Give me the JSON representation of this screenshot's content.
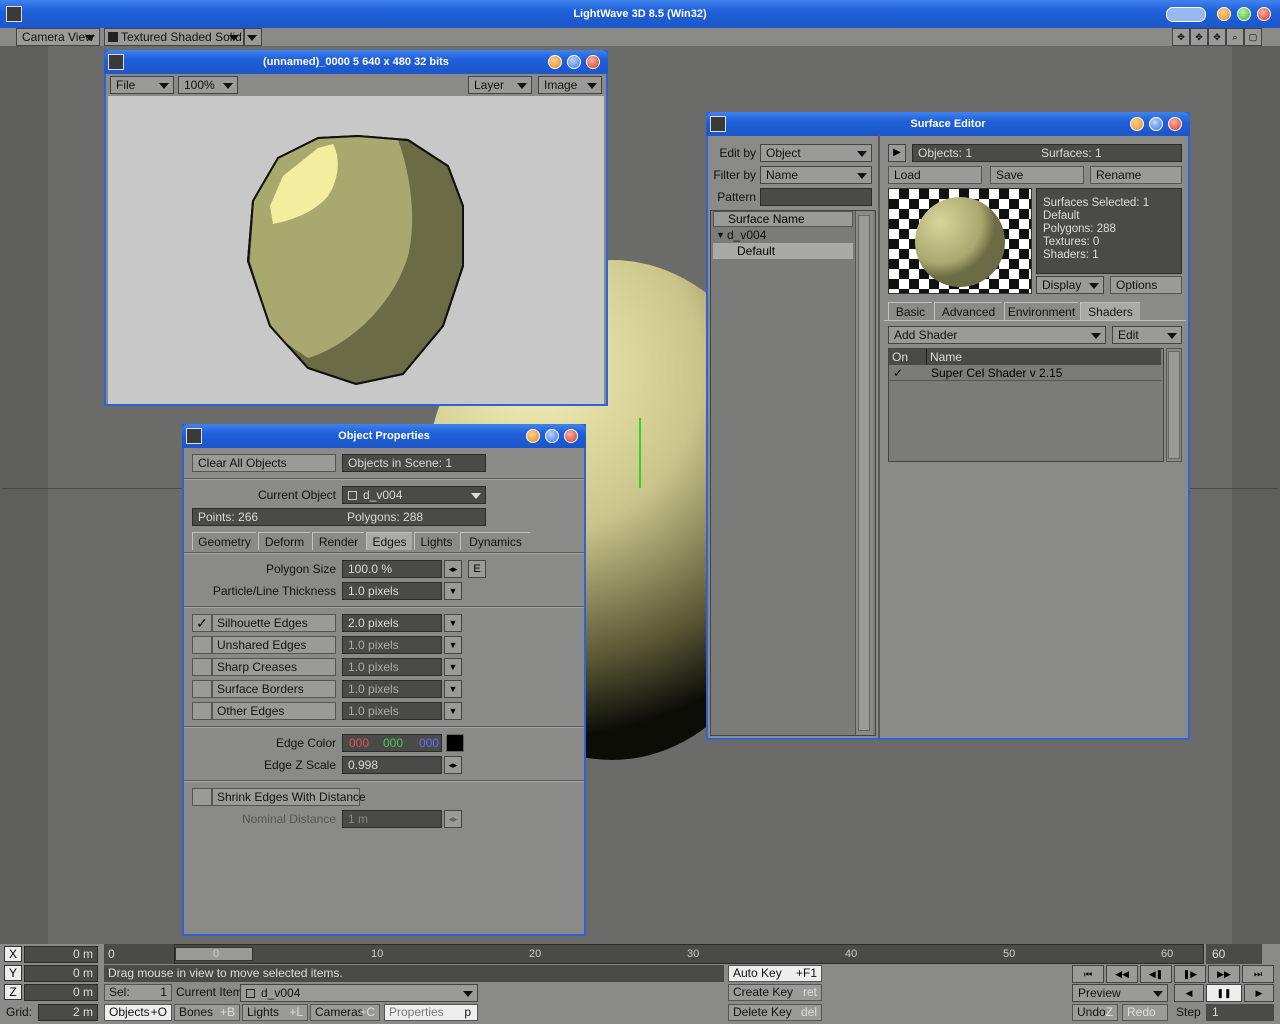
{
  "app": {
    "title": "LightWave 3D 8.5 (Win32)"
  },
  "viewport": {
    "view_mode": "Camera View",
    "shading_mode": "Textured Shaded Solid"
  },
  "render_window": {
    "title": "(unnamed)_0000 5  640 x 480 32 bits",
    "file": "File",
    "zoom": "100%",
    "layer": "Layer",
    "image": "Image"
  },
  "object_properties": {
    "title": "Object Properties",
    "clear_all": "Clear All Objects",
    "objects_in_scene": "Objects in Scene: 1",
    "current_object_label": "Current Object",
    "current_object": "d_v004",
    "points": "Points: 266",
    "polygons": "Polygons: 288",
    "tabs": [
      "Geometry",
      "Deform",
      "Render",
      "Edges",
      "Lights",
      "Dynamics"
    ],
    "polygon_size_label": "Polygon Size",
    "polygon_size": "100.0 %",
    "e_btn": "E",
    "particle_label": "Particle/Line Thickness",
    "particle_value": "1.0 pixels",
    "edges": [
      {
        "label": "Silhouette Edges",
        "value": "2.0 pixels",
        "checked": "✓"
      },
      {
        "label": "Unshared Edges",
        "value": "1.0 pixels",
        "checked": ""
      },
      {
        "label": "Sharp Creases",
        "value": "1.0 pixels",
        "checked": ""
      },
      {
        "label": "Surface Borders",
        "value": "1.0 pixels",
        "checked": ""
      },
      {
        "label": "Other Edges",
        "value": "1.0 pixels",
        "checked": ""
      }
    ],
    "edge_color_label": "Edge Color",
    "edge_r": "000",
    "edge_g": "000",
    "edge_b": "000",
    "edge_z_label": "Edge Z Scale",
    "edge_z": "0.998",
    "shrink_label": "Shrink Edges With Distance",
    "nominal_label": "Nominal Distance",
    "nominal_value": "1 m"
  },
  "surface_editor": {
    "title": "Surface Editor",
    "edit_by_label": "Edit by",
    "edit_by": "Object",
    "filter_by_label": "Filter by",
    "filter_by": "Name",
    "pattern_label": "Pattern",
    "list_header": "Surface Name",
    "tree_object": "d_v004",
    "tree_surface": "Default",
    "objects": "Objects: 1",
    "surfaces": "Surfaces: 1",
    "load": "Load",
    "save": "Save",
    "rename": "Rename",
    "info": [
      "Surfaces Selected: 1",
      "Default",
      "Polygons: 288",
      "Textures: 0",
      "Shaders: 1"
    ],
    "display": "Display",
    "options": "Options",
    "tabs": [
      "Basic",
      "Advanced",
      "Environment",
      "Shaders"
    ],
    "add_shader": "Add Shader",
    "edit": "Edit",
    "col_on": "On",
    "col_name": "Name",
    "shader_check": "✓",
    "shader_name": "Super Cel Shader v 2.15"
  },
  "timeline": {
    "ticks": [
      "0",
      "10",
      "20",
      "30",
      "40",
      "50",
      "60"
    ],
    "start": "0",
    "end": "60"
  },
  "bottom": {
    "x_label": "X",
    "y_label": "Y",
    "z_label": "Z",
    "grid_label": "Grid:",
    "x_val": "0 m",
    "y_val": "0 m",
    "z_val": "0 m",
    "grid_val": "2 m",
    "status": "Drag mouse in view to move selected items.",
    "sel_label": "Sel:",
    "sel_val": "1",
    "current_item_label": "Current Item",
    "current_item": "d_v004",
    "objects": "Objects",
    "objects_key": "+O",
    "bones": "Bones",
    "bones_key": "+B",
    "lights": "Lights",
    "lights_key": "+L",
    "cameras": "Cameras",
    "cameras_key": "+C",
    "properties": "Properties",
    "properties_key": "p",
    "auto_key": "Auto Key",
    "auto_key_short": "+F1",
    "create_key": "Create Key",
    "create_key_short": "ret",
    "delete_key": "Delete Key",
    "delete_key_short": "del",
    "preview": "Preview",
    "undo": "Undo",
    "undo_key": "Z",
    "redo": "Redo",
    "step_label": "Step",
    "step_val": "1"
  }
}
